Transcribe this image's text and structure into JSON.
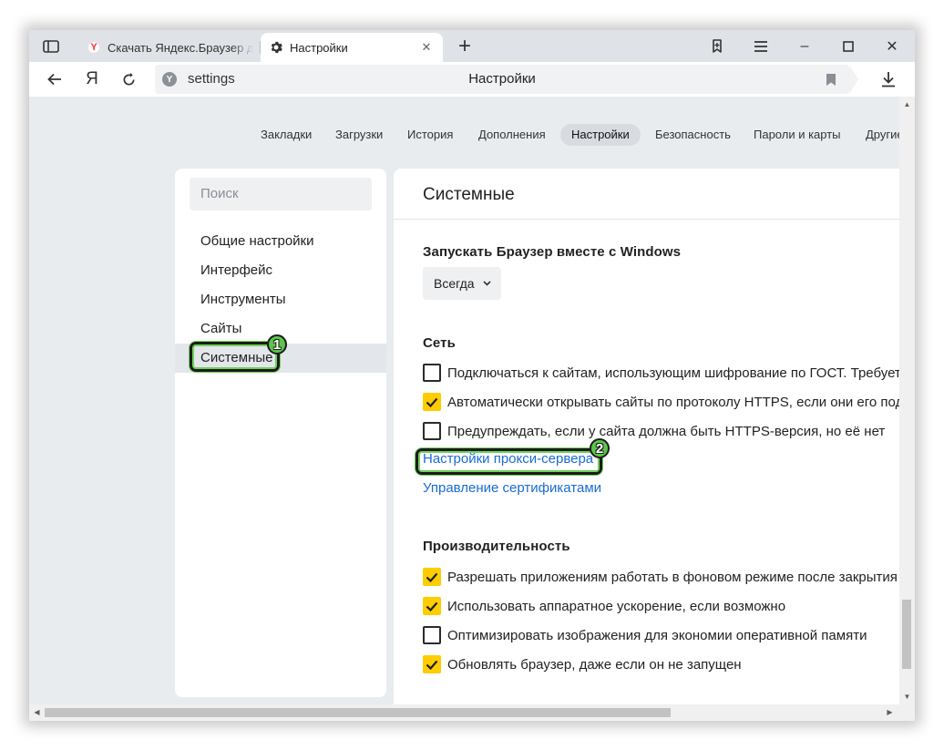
{
  "browser": {
    "tabs": [
      {
        "label": "Скачать Яндекс.Браузер для",
        "favicon": "yandex-favicon",
        "active": false
      },
      {
        "label": "Настройки",
        "favicon": "gear-icon",
        "active": true,
        "close": "✕"
      }
    ],
    "new_tab": "+",
    "window_controls": {
      "sidebar": "sidebar-icon",
      "bookmarks": "bookmarks-icon",
      "menu": "hamburger-icon",
      "minimize": "–",
      "maximize": "☐",
      "close": "✕"
    },
    "address_bar": {
      "home_label": "Я",
      "url": "settings",
      "page_title": "Настройки"
    }
  },
  "top_nav": {
    "items": [
      "Закладки",
      "Загрузки",
      "История",
      "Дополнения",
      "Настройки",
      "Безопасность",
      "Пароли и карты",
      "Другие"
    ],
    "active": "Настройки"
  },
  "sidebar": {
    "search_placeholder": "Поиск",
    "items": [
      "Общие настройки",
      "Интерфейс",
      "Инструменты",
      "Сайты",
      "Системные"
    ],
    "active": "Системные"
  },
  "main": {
    "title": "Системные",
    "startup": {
      "heading": "Запускать Браузер вместе с Windows",
      "value": "Всегда"
    },
    "network": {
      "heading": "Сеть",
      "options": [
        {
          "label": "Подключаться к сайтам, использующим шифрование по ГОСТ. Требуется",
          "checked": false
        },
        {
          "label": "Автоматически открывать сайты по протоколу HTTPS, если они его поддерживают",
          "checked": true
        },
        {
          "label": "Предупреждать, если у сайта должна быть HTTPS-версия, но её нет",
          "checked": false
        }
      ],
      "links": [
        "Настройки прокси-сервера",
        "Управление сертификатами"
      ]
    },
    "performance": {
      "heading": "Производительность",
      "options": [
        {
          "label": "Разрешать приложениям работать в фоновом режиме после закрытия",
          "checked": true
        },
        {
          "label": "Использовать аппаратное ускорение, если возможно",
          "checked": true
        },
        {
          "label": "Оптимизировать изображения для экономии оперативной памяти",
          "checked": false
        },
        {
          "label": "Обновлять браузер, даже если он не запущен",
          "checked": true
        }
      ]
    }
  },
  "annotations": [
    {
      "number": "1",
      "target": "Системные"
    },
    {
      "number": "2",
      "target": "Настройки прокси-сервера"
    }
  ],
  "colors": {
    "accent_checkbox": "#ffcc00",
    "link": "#1a6bd6",
    "annotation_green": "#5cc64a",
    "page_bg": "#e9ecef"
  }
}
